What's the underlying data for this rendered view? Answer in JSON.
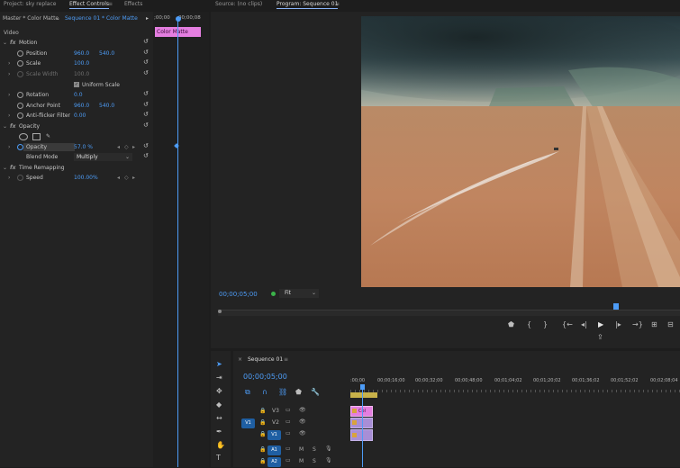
{
  "left_tabs": [
    "Project: sky replace",
    "Effect Controls",
    "Effects"
  ],
  "effect_controls": {
    "master_label": "Master * Color Matte",
    "sequence_label": "Sequence 01 * Color Matte",
    "timecode_start": ";00;00",
    "timecode_end": "00;00;08",
    "clip_name": "Color Matte",
    "video_header": "Video",
    "motion": {
      "name": "Motion",
      "position_label": "Position",
      "position_x": "960.0",
      "position_y": "540.0",
      "scale_label": "Scale",
      "scale_value": "100.0",
      "scale_width_label": "Scale Width",
      "scale_width_value": "100.0",
      "uniform_scale_label": "Uniform Scale",
      "rotation_label": "Rotation",
      "rotation_value": "0.0",
      "anchor_label": "Anchor Point",
      "anchor_x": "960.0",
      "anchor_y": "540.0",
      "antiflicker_label": "Anti-flicker Filter",
      "antiflicker_value": "0.00"
    },
    "opacity": {
      "name": "Opacity",
      "opacity_label": "Opacity",
      "opacity_value": "57.0 %",
      "blend_label": "Blend Mode",
      "blend_value": "Multiply"
    },
    "time_remap": {
      "name": "Time Remapping",
      "speed_label": "Speed",
      "speed_value": "100.00%"
    }
  },
  "monitor_tabs": [
    "Source: (no clips)",
    "Program: Sequence 01"
  ],
  "program": {
    "timecode": "00;00;05;00",
    "fit_label": "Fit"
  },
  "timeline": {
    "sequence_tab": "Sequence 01",
    "timecode": "00;00;05;00",
    "ruler": [
      ":00;00",
      "00;00;16;00",
      "00;00;32;00",
      "00;00;48;00",
      "00;01;04;02",
      "00;01;20;02",
      "00;01;36;02",
      "00;01;52;02",
      "00;02;08;04"
    ],
    "tracks": [
      "V3",
      "V2",
      "V1",
      "A1",
      "A2"
    ],
    "source_patch": [
      "V1",
      "A1"
    ],
    "clip_label": "Col"
  }
}
